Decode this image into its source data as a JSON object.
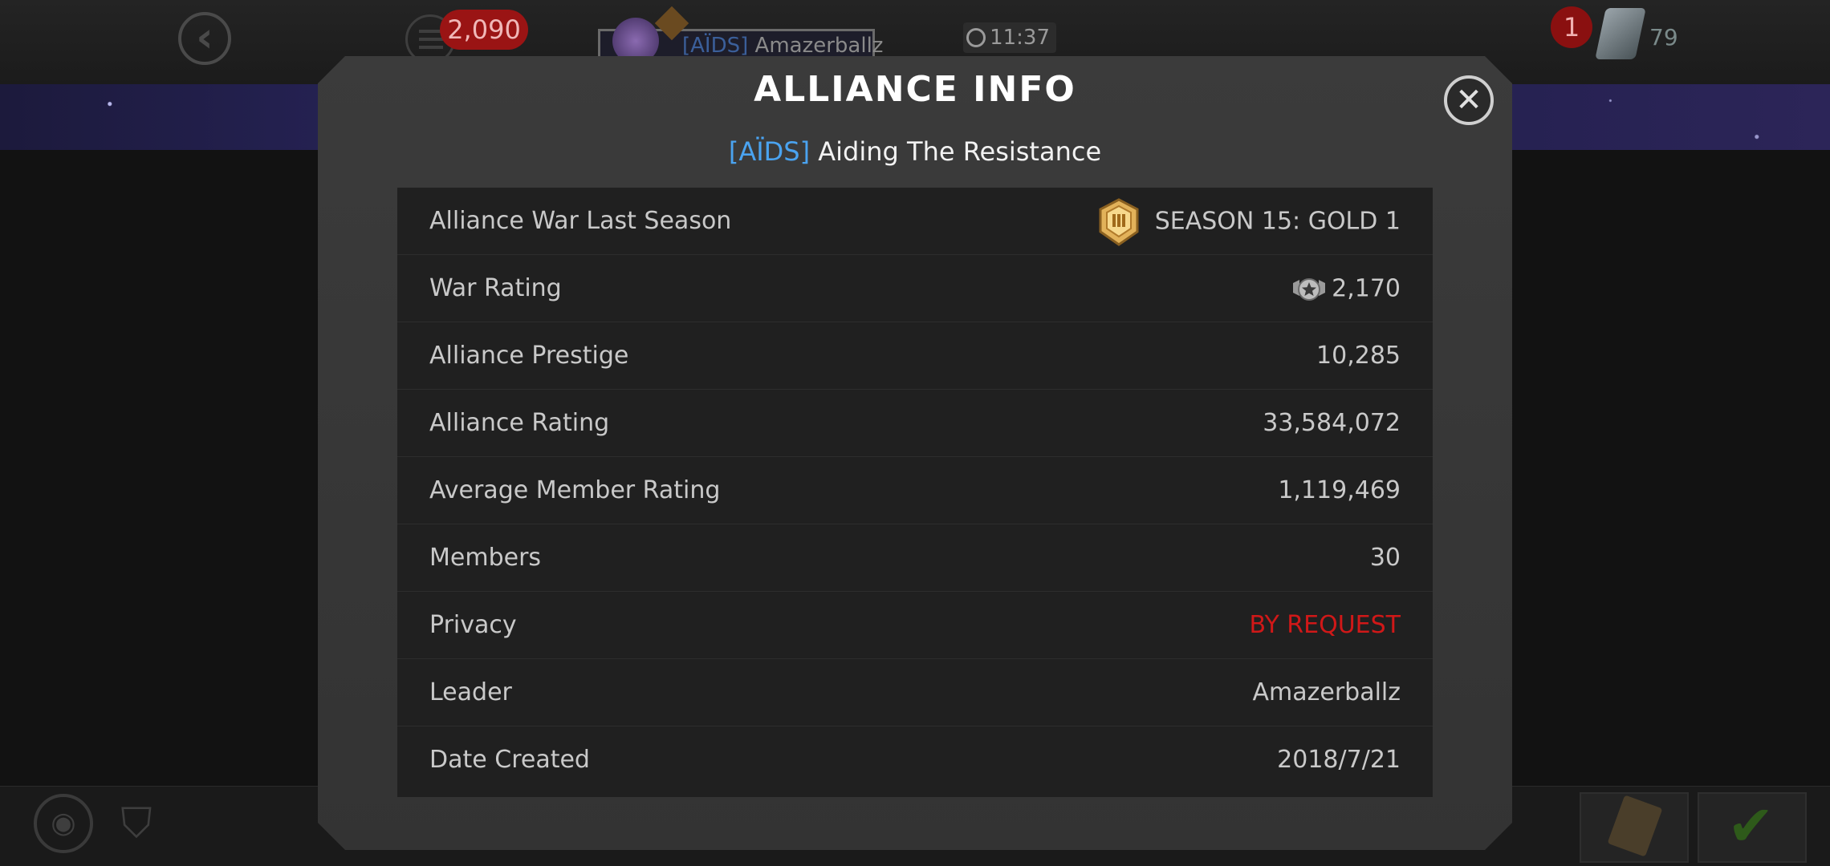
{
  "background": {
    "currency_count": "2,090",
    "player_tag": "[AÏDS]",
    "player_name": "Amazerballz",
    "timer": "11:37",
    "notification_count": "1",
    "resource_count": "79"
  },
  "modal": {
    "title": "ALLIANCE INFO",
    "alliance_tag": "[AÏDS]",
    "alliance_name": "Aiding The Resistance",
    "rows": [
      {
        "label": "Alliance War Last Season",
        "value": "SEASON 15: GOLD 1",
        "icon": "gold-tier-badge-icon"
      },
      {
        "label": "War Rating",
        "value": "2,170",
        "icon": "war-rating-icon"
      },
      {
        "label": "Alliance Prestige",
        "value": "10,285"
      },
      {
        "label": "Alliance Rating",
        "value": "33,584,072"
      },
      {
        "label": "Average Member Rating",
        "value": "1,119,469"
      },
      {
        "label": "Members",
        "value": "30"
      },
      {
        "label": "Privacy",
        "value": "BY REQUEST",
        "color": "#d01818"
      },
      {
        "label": "Leader",
        "value": "Amazerballz"
      },
      {
        "label": "Date Created",
        "value": "2018/7/21"
      }
    ]
  },
  "colors": {
    "accent_tag": "#4aa3f0",
    "privacy_warning": "#d01818",
    "gold_badge": "#e2b25a"
  }
}
